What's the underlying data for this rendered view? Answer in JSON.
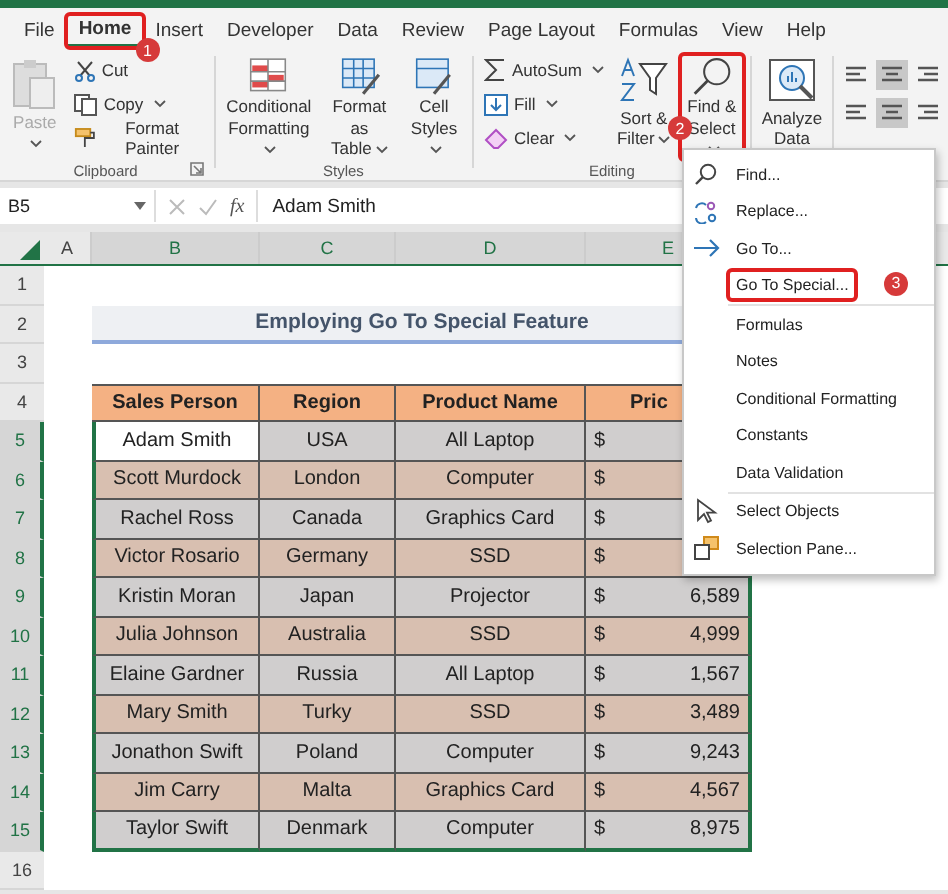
{
  "tabs": [
    {
      "label": "File",
      "selected": false
    },
    {
      "label": "Home",
      "selected": true,
      "callout": "1"
    },
    {
      "label": "Insert",
      "selected": false
    },
    {
      "label": "Developer",
      "selected": false
    },
    {
      "label": "Data",
      "selected": false
    },
    {
      "label": "Review",
      "selected": false
    },
    {
      "label": "Page Layout",
      "selected": false
    },
    {
      "label": "Formulas",
      "selected": false
    },
    {
      "label": "View",
      "selected": false
    },
    {
      "label": "Help",
      "selected": false
    }
  ],
  "ribbon": {
    "groups": [
      {
        "label": "Clipboard",
        "launcher": true,
        "columns": [
          [
            {
              "kind": "paste",
              "lines": [
                "Paste"
              ],
              "dropdown": true,
              "disabled": true
            }
          ],
          [
            {
              "kind": "cut",
              "lines": [
                "Cut"
              ],
              "dropdown": false,
              "disabled": false
            },
            {
              "kind": "copy",
              "lines": [
                "Copy"
              ],
              "dropdown": true,
              "disabled": false
            },
            {
              "kind": "painter",
              "lines": [
                "Format Painter"
              ],
              "dropdown": false,
              "disabled": false
            }
          ]
        ]
      },
      {
        "label": "Styles",
        "columns": [
          [
            {
              "kind": "condfmt",
              "lines": [
                "Conditional",
                "Formatting"
              ],
              "dropdown": true,
              "disabled": false
            }
          ],
          [
            {
              "kind": "table",
              "lines": [
                "Format as",
                "Table"
              ],
              "dropdown": true,
              "disabled": false
            }
          ],
          [
            {
              "kind": "cellstyles",
              "lines": [
                "Cell",
                "Styles"
              ],
              "dropdown": true,
              "disabled": false
            }
          ]
        ]
      },
      {
        "label": "Editing",
        "columns": [
          [
            {
              "kind": "autosum",
              "lines": [
                "AutoSum"
              ],
              "dropdown": true,
              "disabled": false
            },
            {
              "kind": "fill",
              "lines": [
                "Fill"
              ],
              "dropdown": true,
              "disabled": false
            },
            {
              "kind": "clear",
              "lines": [
                "Clear"
              ],
              "dropdown": true,
              "disabled": false
            }
          ],
          [
            {
              "kind": "sort",
              "lines": [
                "Sort &",
                "Filter"
              ],
              "dropdown": true,
              "disabled": false
            }
          ],
          [
            {
              "kind": "find",
              "lines": [
                "Find &",
                "Select"
              ],
              "dropdown": true,
              "disabled": false,
              "callout": "2"
            }
          ]
        ]
      },
      {
        "columns": [
          [
            {
              "kind": "analyze",
              "lines": [
                "Analyze",
                "Data"
              ],
              "dropdown": false,
              "disabled": false
            }
          ]
        ]
      }
    ],
    "alignment_buttons": [
      {
        "kind": "top",
        "selected": false
      },
      {
        "kind": "middle",
        "selected": true
      },
      {
        "kind": "bottom",
        "selected": false
      },
      {
        "kind": "left",
        "selected": false
      },
      {
        "kind": "center",
        "selected": true
      },
      {
        "kind": "right",
        "selected": false
      }
    ]
  },
  "formula_bar": {
    "name_box": "B5",
    "function_label": "fx",
    "value": "Adam Smith"
  },
  "sheet": {
    "columns": [
      "A",
      "B",
      "C",
      "D",
      "E"
    ],
    "rows": [
      "1",
      "2",
      "3",
      "4",
      "5",
      "6",
      "7",
      "8",
      "9",
      "10",
      "11",
      "12",
      "13",
      "14",
      "15",
      "16"
    ],
    "title": "Employing Go To Special Feature",
    "table": {
      "columns": [
        "Sales Person",
        "Region",
        "Product Name",
        "Pric"
      ],
      "rows": [
        {
          "person": "Adam Smith",
          "region": "USA",
          "product": "All Laptop",
          "currency": "$",
          "selected": true
        },
        {
          "person": "Scott Murdock",
          "region": "London",
          "product": "Computer",
          "currency": "$",
          "selected": false
        },
        {
          "person": "Rachel Ross",
          "region": "Canada",
          "product": "Graphics Card",
          "currency": "$",
          "selected": false
        },
        {
          "person": "Victor Rosario",
          "region": "Germany",
          "product": "SSD",
          "currency": "$",
          "selected": false
        },
        {
          "person": "Kristin Moran",
          "region": "Japan",
          "product": "Projector",
          "currency": "$",
          "price": "6,589",
          "selected": false
        },
        {
          "person": "Julia Johnson",
          "region": "Australia",
          "product": "SSD",
          "currency": "$",
          "price": "4,999",
          "selected": false
        },
        {
          "person": "Elaine Gardner",
          "region": "Russia",
          "product": "All Laptop",
          "currency": "$",
          "price": "1,567",
          "selected": false
        },
        {
          "person": "Mary Smith",
          "region": "Turky",
          "product": "SSD",
          "currency": "$",
          "price": "3,489",
          "selected": false
        },
        {
          "person": "Jonathon Swift",
          "region": "Poland",
          "product": "Computer",
          "currency": "$",
          "price": "9,243",
          "selected": false
        },
        {
          "person": "Jim Carry",
          "region": "Malta",
          "product": "Graphics Card",
          "currency": "$",
          "price": "4,567",
          "selected": false
        },
        {
          "person": "Taylor Swift",
          "region": "Denmark",
          "product": "Computer",
          "currency": "$",
          "price": "8,975",
          "selected": false
        }
      ]
    }
  },
  "menu": {
    "sections": [
      [
        {
          "kind": "find",
          "label": "Find..."
        },
        {
          "kind": "replace",
          "label": "Replace..."
        },
        {
          "kind": "goto",
          "label": "Go To..."
        },
        {
          "kind": "plain",
          "label": "Go To Special...",
          "callout": "3"
        }
      ],
      [
        {
          "kind": "plain",
          "label": "Formulas"
        },
        {
          "kind": "plain",
          "label": "Notes"
        },
        {
          "kind": "plain",
          "label": "Conditional Formatting"
        },
        {
          "kind": "plain",
          "label": "Constants"
        },
        {
          "kind": "plain",
          "label": "Data Validation"
        }
      ],
      [
        {
          "kind": "select",
          "label": "Select Objects"
        },
        {
          "kind": "pane",
          "label": "Selection Pane..."
        }
      ]
    ]
  }
}
